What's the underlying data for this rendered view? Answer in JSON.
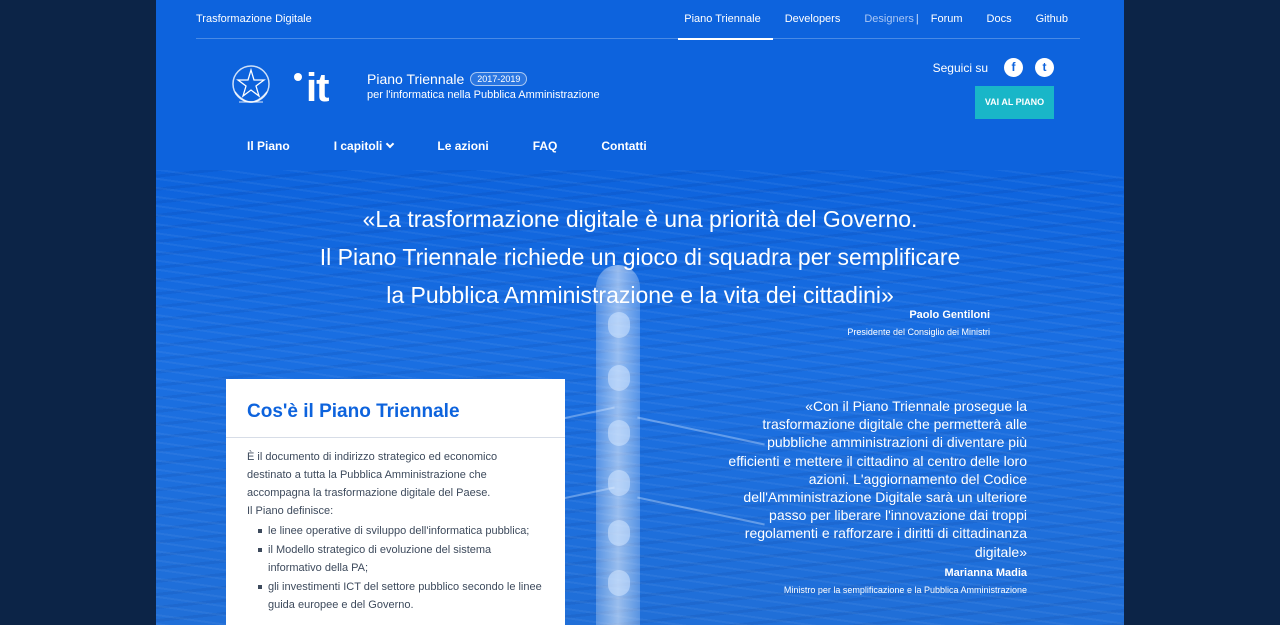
{
  "topbar": {
    "brand": "Trasformazione Digitale",
    "links": [
      {
        "label": "Piano Triennale",
        "state": "active"
      },
      {
        "label": "Developers",
        "state": "normal"
      },
      {
        "label": "Designers",
        "state": "muted"
      },
      {
        "label": "Forum",
        "state": "normal"
      },
      {
        "label": "Docs",
        "state": "normal"
      },
      {
        "label": "Github",
        "state": "normal"
      }
    ]
  },
  "header": {
    "logo_text": "it",
    "title": "Piano Triennale",
    "year_badge": "2017-2019",
    "subtitle": "per l'informatica nella Pubblica Amministrazione",
    "follow_label": "Seguici su",
    "social": [
      {
        "icon": "facebook-icon",
        "glyph": "f"
      },
      {
        "icon": "twitter-icon",
        "glyph": "t"
      }
    ],
    "cta_label": "VAI AL PIANO",
    "accent_color": "#19b6c8"
  },
  "nav": {
    "items": [
      {
        "label": "Il Piano",
        "dropdown": false
      },
      {
        "label": "I capitoli",
        "dropdown": true
      },
      {
        "label": "Le azioni",
        "dropdown": false
      },
      {
        "label": "FAQ",
        "dropdown": false
      },
      {
        "label": "Contatti",
        "dropdown": false
      }
    ]
  },
  "hero": {
    "quote_lines": [
      "«La trasformazione digitale è una priorità del Governo.",
      "Il Piano Triennale richiede un gioco di squadra per semplificare",
      "la Pubblica Amministrazione e la vita dei cittadini»"
    ],
    "author": "Paolo Gentiloni",
    "role": "Presidente del Consiglio dei Ministri"
  },
  "card": {
    "title": "Cos'è il Piano Triennale",
    "intro": "È il documento di indirizzo strategico ed economico destinato a tutta la Pubblica Amministrazione che accompagna la trasformazione digitale del Paese.",
    "defines_label": "Il Piano definisce:",
    "items": [
      "le linee operative di sviluppo dell'informatica pubblica;",
      "il Modello strategico di evoluzione del sistema informativo della PA;",
      "gli investimenti ICT del settore pubblico secondo le linee guida europee e del Governo."
    ]
  },
  "quote2": {
    "text": "«Con il Piano Triennale prosegue la trasformazione digitale che permetterà alle pubbliche amministrazioni di diventare più efficienti e mettere il cittadino al centro delle loro azioni. L'aggiornamento del Codice dell'Amministrazione Digitale sarà un ulteriore passo per liberare l'innovazione dai troppi regolamenti e rafforzare i diritti di cittadinanza digitale»",
    "author": "Marianna Madia",
    "role": "Ministro per la semplificazione e la Pubblica Amministrazione"
  },
  "colors": {
    "page_bg": "#0c2447",
    "primary": "#0d63dd"
  }
}
